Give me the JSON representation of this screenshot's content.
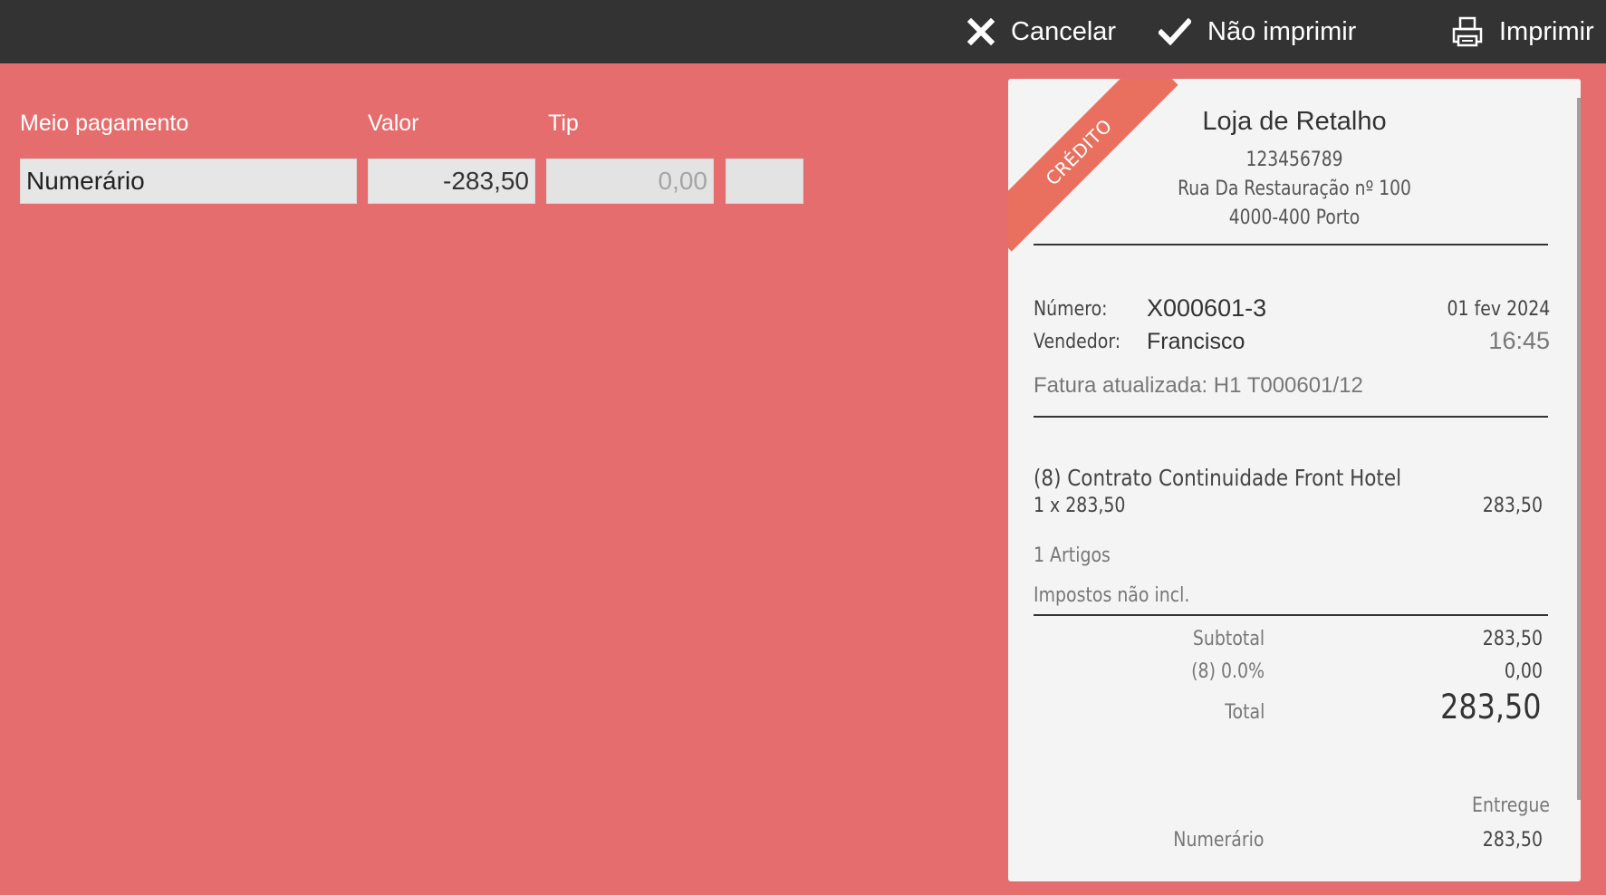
{
  "toolbar": {
    "cancel_label": "Cancelar",
    "no_print_label": "Não imprimir",
    "print_label": "Imprimir"
  },
  "payment": {
    "columns": {
      "method": "Meio pagamento",
      "amount": "Valor",
      "tip": "Tip"
    },
    "method": "Numerário",
    "amount": "-283,50",
    "tip": "0,00"
  },
  "receipt": {
    "ribbon": "CRÉDITO",
    "store_name": "Loja de Retalho",
    "tax_id": "123456789",
    "address_line1": "Rua Da Restauração nº 100",
    "address_line2": "4000-400 Porto",
    "number_label": "Número:",
    "number": "X000601-3",
    "date": "01 fev 2024",
    "seller_label": "Vendedor:",
    "seller": "Francisco",
    "time": "16:45",
    "updated_invoice": "Fatura atualizada: H1 T000601/12",
    "items": [
      {
        "name": "(8) Contrato Continuidade Front Hotel",
        "qty_price": "1 x 283,50",
        "total": "283,50"
      }
    ],
    "item_count": "1 Artigos",
    "tax_note": "Impostos não incl.",
    "subtotal_label": "Subtotal",
    "subtotal": "283,50",
    "tax_label": "(8) 0.0%",
    "tax_value": "0,00",
    "total_label": "Total",
    "total": "283,50",
    "delivered_label": "Entregue",
    "payment_method": "Numerário",
    "payment_amount": "283,50"
  },
  "colors": {
    "background": "#e56d6d",
    "topbar": "#333333",
    "ribbon": "#e9705e",
    "receipt_bg": "#f4f4f4"
  },
  "icons": {
    "cancel": "close-icon",
    "no_print": "check-icon",
    "print": "printer-icon"
  }
}
